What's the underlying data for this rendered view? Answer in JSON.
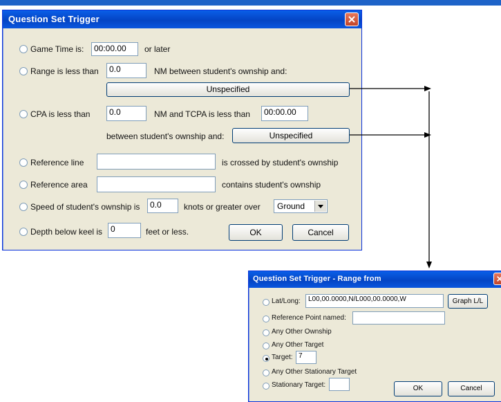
{
  "main_dialog": {
    "title": "Question Set Trigger",
    "game_time": {
      "label": "Game Time is:",
      "value": "00:00.00",
      "suffix": "or later"
    },
    "range": {
      "label": "Range is less than",
      "value": "0.0",
      "suffix": "NM between student's ownship and:",
      "button": "Unspecified"
    },
    "cpa": {
      "label": "CPA is less than",
      "value": "0.0",
      "mid": "NM and TCPA is less than",
      "tcpa_value": "00:00.00",
      "suffix": "between student's ownship and:",
      "button": "Unspecified"
    },
    "reference_line": {
      "label": "Reference line",
      "value": "",
      "suffix": "is crossed by student's ownship"
    },
    "reference_area": {
      "label": "Reference area",
      "value": "",
      "suffix": "contains student's ownship"
    },
    "speed": {
      "label": "Speed of student's ownship is",
      "value": "0.0",
      "mid": "knots or greater over",
      "select_value": "Ground"
    },
    "depth": {
      "label": "Depth below keel is",
      "value": "0",
      "suffix": "feet or less."
    },
    "ok": "OK",
    "cancel": "Cancel"
  },
  "range_dialog": {
    "title": "Question Set Trigger - Range from",
    "latlong": {
      "label": "Lat/Long:",
      "value": "L00,00.0000,N/L000,00.0000,W",
      "button": "Graph L/L"
    },
    "reference_point": {
      "label": "Reference Point named:",
      "value": ""
    },
    "any_other_ownship": "Any Other Ownship",
    "any_other_target": "Any Other Target",
    "target": {
      "label": "Target:",
      "value": "7",
      "selected": true
    },
    "any_other_stationary": "Any Other Stationary Target",
    "stationary_target": {
      "label": "Stationary Target:",
      "value": ""
    },
    "ok": "OK",
    "cancel": "Cancel"
  },
  "colors": {
    "title_blue": "#0444c4",
    "dialog_bg": "#ece9d8",
    "close_red": "#c1452a"
  }
}
